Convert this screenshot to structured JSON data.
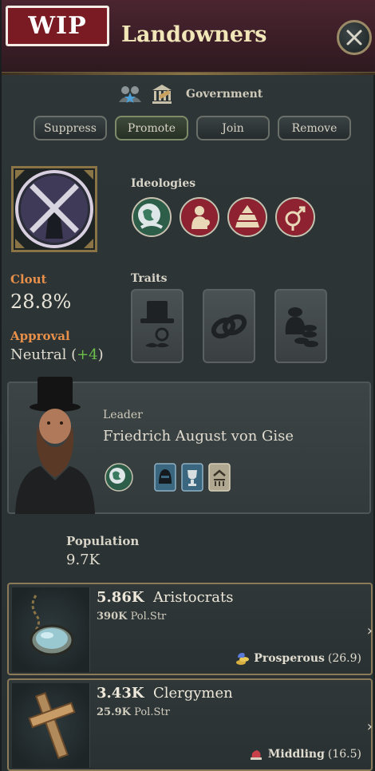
{
  "header": {
    "badge": "WIP",
    "title": "Landowners"
  },
  "government": {
    "label": "Government"
  },
  "actions": [
    {
      "label": "Suppress"
    },
    {
      "label": "Promote"
    },
    {
      "label": "Join"
    },
    {
      "label": "Remove"
    }
  ],
  "ideologies": {
    "title": "Ideologies"
  },
  "clout": {
    "label": "Clout",
    "value": "28.8%"
  },
  "approval": {
    "label": "Approval",
    "value": "Neutral",
    "delta": "+4"
  },
  "traits": {
    "title": "Traits"
  },
  "leader": {
    "label": "Leader",
    "name": "Friedrich August von Gise"
  },
  "population": {
    "label": "Population",
    "value": "9.7K"
  },
  "pops": [
    {
      "count": "5.86K",
      "name": "Aristocrats",
      "pol_str": "390K",
      "pol_str_label": "Pol.Str",
      "status": "Prosperous",
      "sol": "(26.9)"
    },
    {
      "count": "3.43K",
      "name": "Clergymen",
      "pol_str": "25.9K",
      "pol_str_label": "Pol.Str",
      "status": "Middling",
      "sol": "(16.5)"
    }
  ],
  "colors": {
    "accent_orange": "#e8904a",
    "positive_green": "#6cc04a",
    "header_maroon": "#4a2530",
    "gold_border": "#8a7446"
  }
}
